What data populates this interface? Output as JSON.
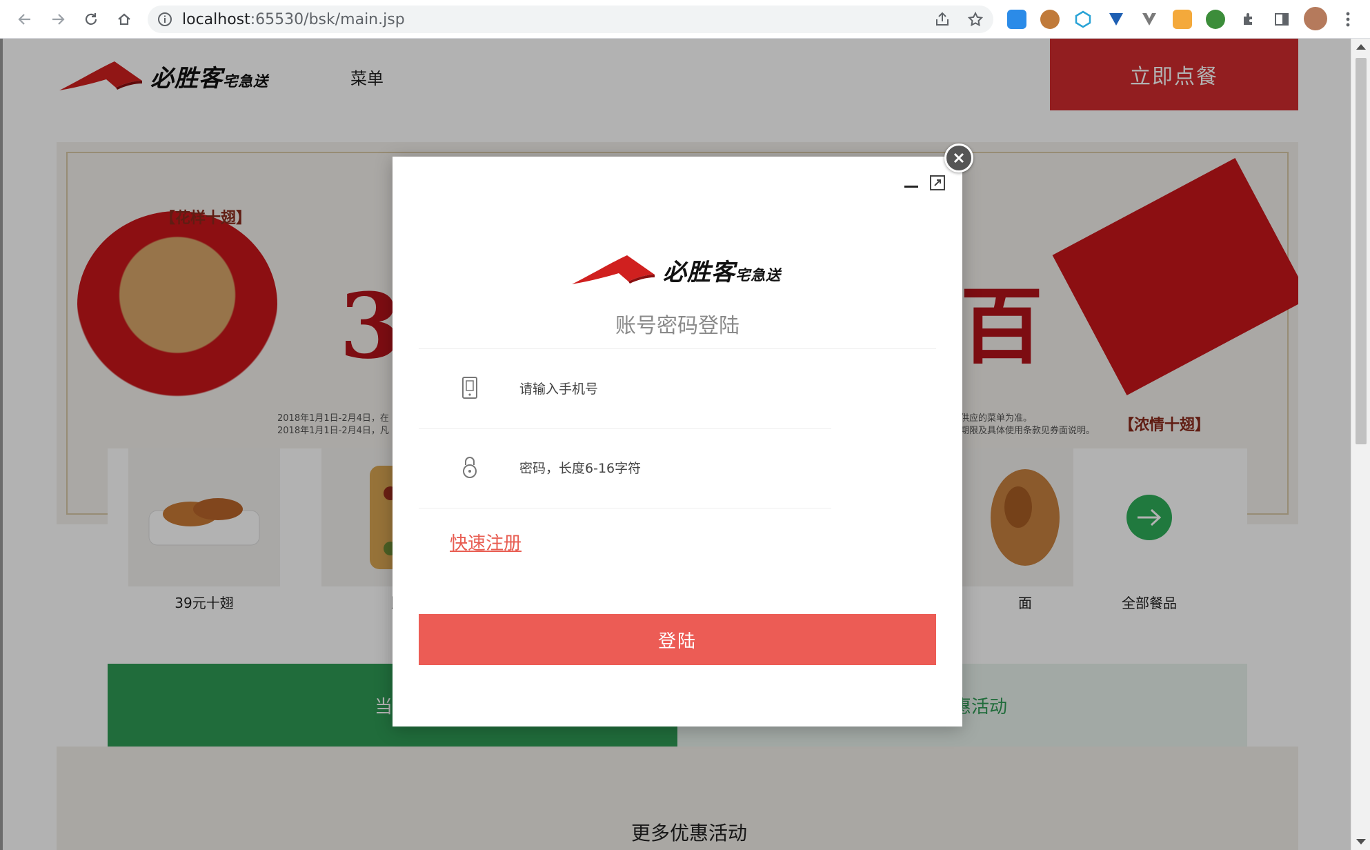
{
  "browser": {
    "url_host": "localhost",
    "url_rest": ":65530/bsk/main.jsp"
  },
  "header": {
    "brand": "必胜客",
    "brand_sub": "宅急送",
    "menu_label": "菜单",
    "order_label": "立即点餐"
  },
  "banner": {
    "tag_left": "【花样十翅】",
    "tag_right": "【浓情十翅】",
    "big_left": "3",
    "big_right": "百",
    "fine_left": [
      "2018年1月1日-2月4日，在",
      "2018年1月1日-2月4日，凡"
    ],
    "fine_right": [
      "供应的菜单为准。",
      "期限及具体使用条款见券面说明。"
    ]
  },
  "categories": [
    {
      "label": "39元十翅"
    },
    {
      "label": "比"
    },
    {
      "label": "面"
    },
    {
      "label": "全部餐品"
    }
  ],
  "tabs": {
    "a": "当季",
    "b": "多优惠活动"
  },
  "more_title": "更多优惠活动",
  "dialog": {
    "title": "账号密码登陆",
    "phone_placeholder": "请输入手机号",
    "password_placeholder": "密码，长度6-16字符",
    "register_label": "快速注册",
    "login_label": "登陆"
  },
  "colors": {
    "brand_red": "#d12c2e",
    "login_button": "#ec5c55",
    "green": "#2e9b55"
  }
}
